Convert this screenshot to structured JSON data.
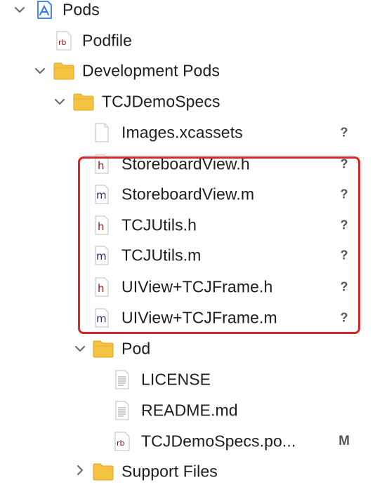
{
  "tree": {
    "pods": {
      "label": "Pods",
      "icon": "xcode-project-icon"
    },
    "podfile": {
      "label": "Podfile",
      "badge": "rb"
    },
    "development_pods": {
      "label": "Development Pods"
    },
    "tcjdemospecs": {
      "label": "TCJDemoSpecs"
    },
    "files": [
      {
        "label": "Images.xcassets",
        "type": "asset",
        "status": "?"
      },
      {
        "label": "StoreboardView.h",
        "type": "h",
        "status": "?"
      },
      {
        "label": "StoreboardView.m",
        "type": "m",
        "status": "?"
      },
      {
        "label": "TCJUtils.h",
        "type": "h",
        "status": "?"
      },
      {
        "label": "TCJUtils.m",
        "type": "m",
        "status": "?"
      },
      {
        "label": "UIView+TCJFrame.h",
        "type": "h",
        "status": "?"
      },
      {
        "label": "UIView+TCJFrame.m",
        "type": "m",
        "status": "?"
      }
    ],
    "pod_group": {
      "label": "Pod"
    },
    "pod_files": [
      {
        "label": "LICENSE",
        "type": "text"
      },
      {
        "label": "README.md",
        "type": "text"
      },
      {
        "label": "TCJDemoSpecs.po...",
        "type": "rb",
        "status": "M"
      }
    ],
    "support_files": {
      "label": "Support Files"
    }
  },
  "colors": {
    "folder": "#f5c242",
    "h_letter": "#8b1a1a",
    "m_letter": "#3a2670",
    "rb_letter": "#a31515",
    "highlight": "#d9262c"
  }
}
